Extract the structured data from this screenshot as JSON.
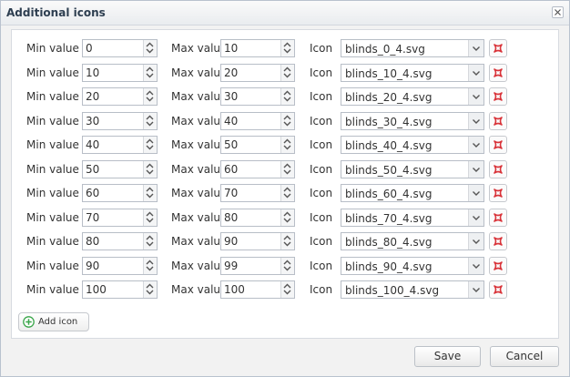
{
  "dialog": {
    "title": "Additional icons",
    "close_icon": "close-icon"
  },
  "labels": {
    "min": "Min value",
    "max": "Max value",
    "icon": "Icon"
  },
  "rows": [
    {
      "min": "0",
      "max": "10",
      "icon": "blinds_0_4.svg"
    },
    {
      "min": "10",
      "max": "20",
      "icon": "blinds_10_4.svg"
    },
    {
      "min": "20",
      "max": "30",
      "icon": "blinds_20_4.svg"
    },
    {
      "min": "30",
      "max": "40",
      "icon": "blinds_30_4.svg"
    },
    {
      "min": "40",
      "max": "50",
      "icon": "blinds_40_4.svg"
    },
    {
      "min": "50",
      "max": "60",
      "icon": "blinds_50_4.svg"
    },
    {
      "min": "60",
      "max": "70",
      "icon": "blinds_60_4.svg"
    },
    {
      "min": "70",
      "max": "80",
      "icon": "blinds_70_4.svg"
    },
    {
      "min": "80",
      "max": "90",
      "icon": "blinds_80_4.svg"
    },
    {
      "min": "90",
      "max": "99",
      "icon": "blinds_90_4.svg"
    },
    {
      "min": "100",
      "max": "100",
      "icon": "blinds_100_4.svg"
    }
  ],
  "add_button": {
    "label": "Add icon",
    "icon": "plus-circle-icon"
  },
  "footer": {
    "save_label": "Save",
    "cancel_label": "Cancel"
  },
  "colors": {
    "delete_icon": "#d9343a",
    "add_icon": "#3aa64a",
    "title_text": "#2d3e50"
  }
}
